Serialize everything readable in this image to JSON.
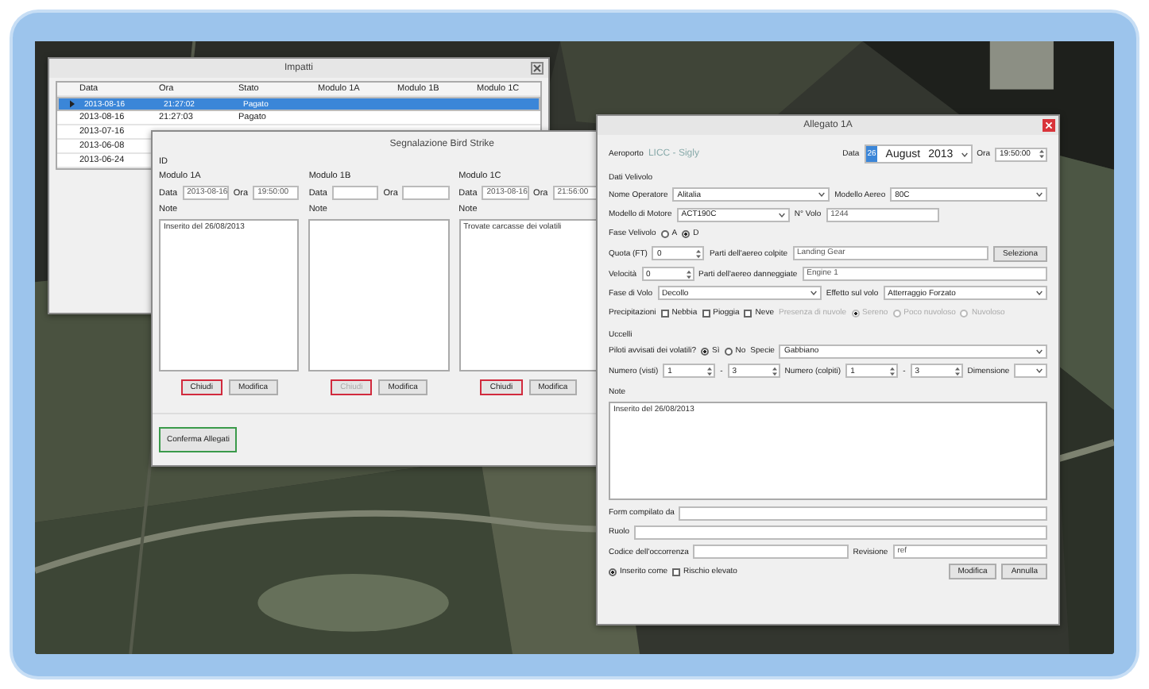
{
  "impatti": {
    "title": "Impatti",
    "columns": [
      "Data",
      "Ora",
      "Stato",
      "Modulo 1A",
      "Modulo 1B",
      "Modulo 1C"
    ],
    "rows": [
      {
        "selected": true,
        "cells": [
          "2013-08-16",
          "21:27:02",
          "Pagato"
        ]
      },
      {
        "selected": false,
        "cells": [
          "2013-08-16",
          "21:27:03",
          "Pagato"
        ]
      },
      {
        "selected": false,
        "cells": [
          "2013-07-16"
        ]
      },
      {
        "selected": false,
        "cells": [
          "2013-06-08"
        ]
      },
      {
        "selected": false,
        "cells": [
          "2013-06-24"
        ]
      }
    ]
  },
  "segnalazione": {
    "title": "Segnalazione Bird Strike",
    "id_label": "ID",
    "modules": [
      {
        "title": "Modulo 1A",
        "data_label": "Data",
        "data_value": "2013-08-16",
        "ora_label": "Ora",
        "ora_value": "19:50:00",
        "note_label": "Note",
        "note": "Inserito del 26/08/2013",
        "buttons": [
          {
            "label": "Chiudi",
            "highlighted": true,
            "disabled": false
          },
          {
            "label": "Modifica",
            "highlighted": false,
            "disabled": false
          }
        ]
      },
      {
        "title": "Modulo 1B",
        "data_label": "Data",
        "ora_label": "Ora",
        "note_label": "Note",
        "buttons": [
          {
            "label": "Chiudi",
            "highlighted": true,
            "disabled": true
          },
          {
            "label": "Modifica",
            "highlighted": false,
            "disabled": false
          }
        ]
      },
      {
        "title": "Modulo 1C",
        "data_label": "Data",
        "data_value": "2013-08-16",
        "ora_label": "Ora",
        "ora_value": "21:56:00",
        "note_label": "Note",
        "note": "Trovate carcasse dei volatili",
        "buttons": [
          {
            "label": "Chiudi",
            "highlighted": true,
            "disabled": false
          },
          {
            "label": "Modifica",
            "highlighted": false,
            "disabled": false
          }
        ]
      }
    ],
    "confirm": "Conferma Allegati"
  },
  "allegato": {
    "title": "Allegato 1A",
    "rows": [
      {
        "items": [
          {
            "kind": "label",
            "text": "Aeroporto"
          },
          {
            "kind": "value",
            "text": "LICC - Sigly"
          },
          {
            "kind": "spacer"
          },
          {
            "kind": "label",
            "text": "Data"
          },
          {
            "kind": "date",
            "day": "26",
            "month": "August",
            "year": "2013"
          },
          {
            "kind": "label",
            "text": "Ora"
          },
          {
            "kind": "spin",
            "value": "19:50:00"
          }
        ]
      },
      {
        "items": [
          {
            "kind": "heading",
            "text": "Dati Velivolo"
          }
        ]
      },
      {
        "items": [
          {
            "kind": "label",
            "text": "Nome Operatore"
          },
          {
            "kind": "select",
            "value": "Alitalia"
          },
          {
            "kind": "label",
            "text": "Modello Aereo"
          },
          {
            "kind": "select",
            "value": "80C"
          }
        ]
      },
      {
        "items": [
          {
            "kind": "label",
            "text": "Modello di Motore"
          },
          {
            "kind": "select",
            "value": "ACT190C"
          },
          {
            "kind": "label",
            "text": "N° Volo"
          },
          {
            "kind": "text",
            "value": "1244"
          },
          {
            "kind": "spacer"
          }
        ]
      },
      {
        "items": [
          {
            "kind": "label",
            "text": "Fase Velivolo"
          },
          {
            "kind": "radio",
            "text": "A",
            "checked": false,
            "disabled": false
          },
          {
            "kind": "radio",
            "text": "D",
            "checked": true,
            "disabled": false
          },
          {
            "kind": "spacer"
          }
        ]
      },
      {
        "items": [
          {
            "kind": "label",
            "text": "Quota (FT)"
          },
          {
            "kind": "spin",
            "value": "0"
          },
          {
            "kind": "label",
            "text": "Parti dell'aereo colpite"
          },
          {
            "kind": "text",
            "value": "Landing Gear"
          },
          {
            "kind": "button",
            "text": "Seleziona"
          }
        ]
      },
      {
        "items": [
          {
            "kind": "label",
            "text": "Velocità"
          },
          {
            "kind": "spin",
            "value": "0"
          },
          {
            "kind": "label",
            "text": "Parti dell'aereo danneggiate"
          },
          {
            "kind": "text",
            "value": "Engine 1"
          }
        ]
      },
      {
        "items": [
          {
            "kind": "label",
            "text": "Fase di Volo"
          },
          {
            "kind": "select",
            "value": "Decollo"
          },
          {
            "kind": "label",
            "text": "Effetto sul volo"
          },
          {
            "kind": "select",
            "value": "Atterraggio Forzato"
          }
        ]
      },
      {
        "items": [
          {
            "kind": "label",
            "text": "Precipitazioni"
          },
          {
            "kind": "check",
            "text": "Nebbia",
            "checked": false,
            "disabled": false
          },
          {
            "kind": "check",
            "text": "Pioggia",
            "checked": false,
            "disabled": false
          },
          {
            "kind": "check",
            "text": "Neve",
            "checked": false,
            "disabled": false
          },
          {
            "kind": "note",
            "text": "Presenza di nuvole"
          },
          {
            "kind": "radio",
            "text": "Sereno",
            "checked": true,
            "disabled": true
          },
          {
            "kind": "radio",
            "text": "Poco nuvoloso",
            "checked": false,
            "disabled": true
          },
          {
            "kind": "radio",
            "text": "Nuvoloso",
            "checked": false,
            "disabled": true
          }
        ]
      },
      {
        "items": [
          {
            "kind": "heading",
            "text": "Uccelli"
          }
        ]
      },
      {
        "items": [
          {
            "kind": "label",
            "text": "Piloti avvisati dei volatili?"
          },
          {
            "kind": "radio",
            "text": "Sì",
            "checked": true,
            "disabled": false
          },
          {
            "kind": "radio",
            "text": "No",
            "checked": false,
            "disabled": false
          },
          {
            "kind": "label",
            "text": "Specie"
          },
          {
            "kind": "select",
            "value": "Gabbiano"
          }
        ]
      },
      {
        "items": [
          {
            "kind": "label",
            "text": "Numero (visti)"
          },
          {
            "kind": "spin",
            "value": "1"
          },
          {
            "kind": "dash",
            "text": "-"
          },
          {
            "kind": "spin",
            "value": "3"
          },
          {
            "kind": "label",
            "text": "Numero (colpiti)"
          },
          {
            "kind": "spin",
            "value": "1"
          },
          {
            "kind": "dash",
            "text": "-"
          },
          {
            "kind": "spin",
            "value": "3"
          },
          {
            "kind": "label",
            "text": "Dimensione"
          },
          {
            "kind": "select"
          }
        ]
      },
      {
        "items": [
          {
            "kind": "heading",
            "text": "Note"
          }
        ]
      },
      {
        "items": [
          {
            "kind": "area",
            "value": "Inserito del 26/08/2013"
          }
        ]
      },
      {
        "items": [
          {
            "kind": "label",
            "text": "Form compilato da"
          },
          {
            "kind": "text"
          }
        ]
      },
      {
        "items": [
          {
            "kind": "label",
            "text": "Ruolo"
          },
          {
            "kind": "text"
          }
        ]
      },
      {
        "items": [
          {
            "kind": "label",
            "text": "Codice dell'occorrenza"
          },
          {
            "kind": "text"
          },
          {
            "kind": "label",
            "text": "Revisione"
          },
          {
            "kind": "text",
            "value": "ref"
          }
        ]
      },
      {
        "items": [
          {
            "kind": "radio",
            "text": "Inserito come",
            "checked": true,
            "disabled": false
          },
          {
            "kind": "check",
            "text": "Rischio elevato",
            "checked": false,
            "disabled": false
          },
          {
            "kind": "spacer"
          },
          {
            "kind": "button",
            "text": "Modifica"
          },
          {
            "kind": "button",
            "text": "Annulla"
          }
        ]
      }
    ]
  }
}
